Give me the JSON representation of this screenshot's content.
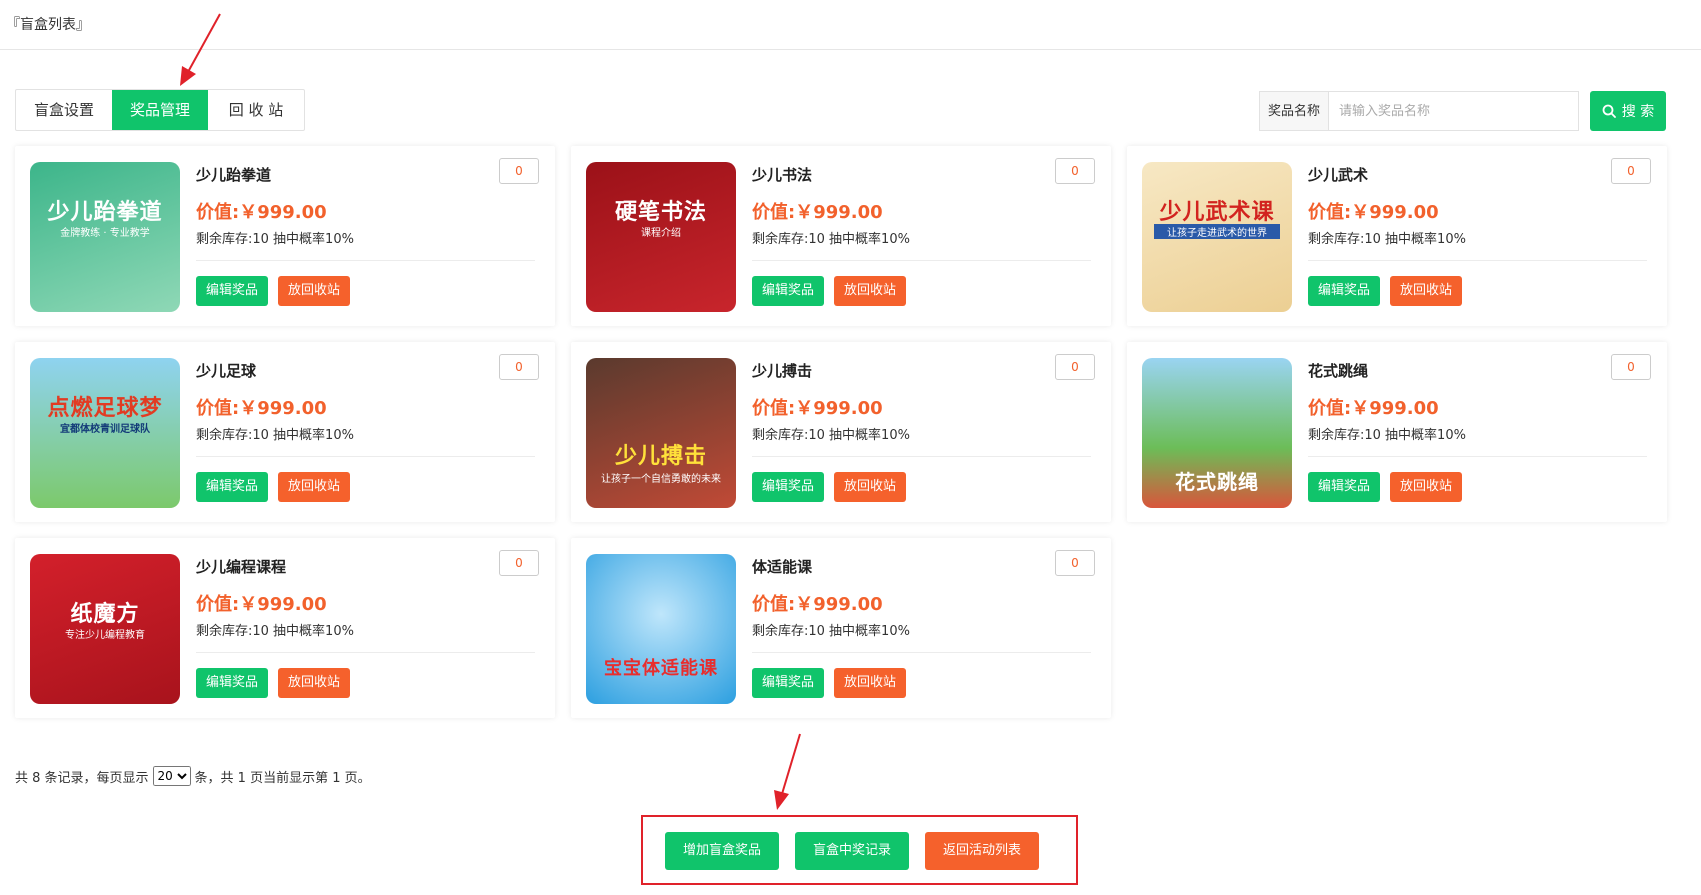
{
  "page": {
    "title": "『盲盒列表』"
  },
  "tabs": [
    {
      "label": "盲盒设置",
      "active": false
    },
    {
      "label": "奖品管理",
      "active": true
    },
    {
      "label": "回 收 站",
      "active": false
    }
  ],
  "search": {
    "label": "奖品名称",
    "placeholder": "请输入奖品名称",
    "button_label": "搜 索",
    "button_icon": "search-icon"
  },
  "prizes": [
    {
      "name": "少儿跆拳道",
      "price": "价值:￥999.00",
      "stock": "剩余库存:10 抽中概率10%",
      "qty": "0",
      "thumb_title": "少儿跆拳道",
      "thumb_sub": "金牌教练 · 专业教学",
      "thumb_color": "#3cb58a"
    },
    {
      "name": "少儿书法",
      "price": "价值:￥999.00",
      "stock": "剩余库存:10 抽中概率10%",
      "qty": "0",
      "thumb_title": "硬笔书法",
      "thumb_sub": "课程介绍",
      "thumb_color": "#9b1118"
    },
    {
      "name": "少儿武术",
      "price": "价值:￥999.00",
      "stock": "剩余库存:10 抽中概率10%",
      "qty": "0",
      "thumb_title": "少儿武术课",
      "thumb_sub": "让孩子走进武术的世界",
      "thumb_color": "#f4e1b8"
    },
    {
      "name": "少儿足球",
      "price": "价值:￥999.00",
      "stock": "剩余库存:10 抽中概率10%",
      "qty": "0",
      "thumb_title": "点燃足球梦",
      "thumb_sub": "宜都体校青训足球队",
      "thumb_color": "#6fc4e8"
    },
    {
      "name": "少儿搏击",
      "price": "价值:￥999.00",
      "stock": "剩余库存:10 抽中概率10%",
      "qty": "0",
      "thumb_title": "少儿搏击",
      "thumb_sub": "让孩子一个自信勇敢的未来",
      "thumb_color": "#b84034"
    },
    {
      "name": "花式跳绳",
      "price": "价值:￥999.00",
      "stock": "剩余库存:10 抽中概率10%",
      "qty": "0",
      "thumb_title": "花式跳绳",
      "thumb_sub": "",
      "thumb_color": "#4a9fd6"
    },
    {
      "name": "少儿编程课程",
      "price": "价值:￥999.00",
      "stock": "剩余库存:10 抽中概率10%",
      "qty": "0",
      "thumb_title": "纸魔方",
      "thumb_sub": "专注少儿编程教育",
      "thumb_color": "#d3202b"
    },
    {
      "name": "体适能课",
      "price": "价值:￥999.00",
      "stock": "剩余库存:10 抽中概率10%",
      "qty": "0",
      "thumb_title": "宝宝体适能课",
      "thumb_sub": "",
      "thumb_color": "#2c9fe0"
    }
  ],
  "card_buttons": {
    "edit": "编辑奖品",
    "recycle": "放回收站"
  },
  "pager": {
    "prefix": "共 8 条记录，每页显示",
    "page_size": "20",
    "suffix": "条，共 1 页当前显示第 1 页。"
  },
  "actions": {
    "add": "增加盲盒奖品",
    "records": "盲盒中奖记录",
    "back": "返回活动列表"
  },
  "colors": {
    "green": "#10c46b",
    "orange": "#f5612c",
    "red_annotation": "#e0222a"
  }
}
